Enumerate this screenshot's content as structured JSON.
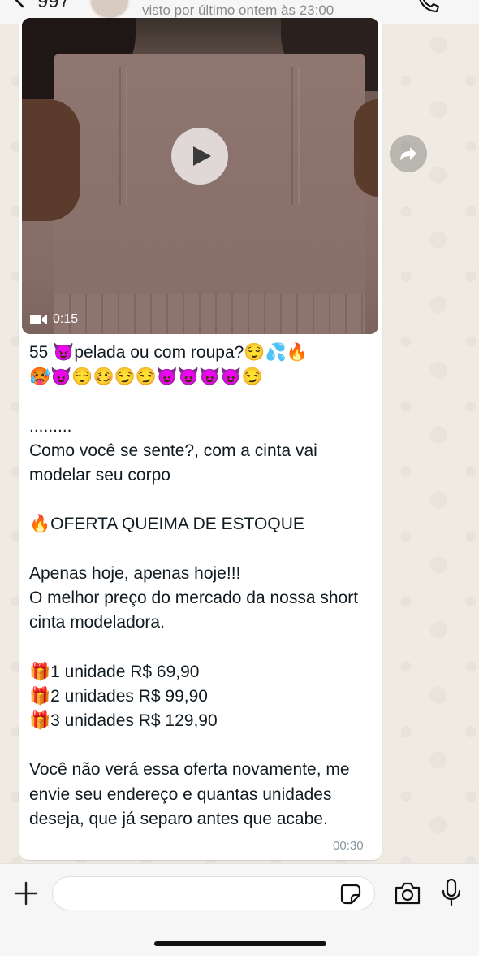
{
  "header": {
    "contact_name": "997",
    "last_seen": "visto por último ontem às 23:00"
  },
  "message": {
    "video_duration": "0:15",
    "text": "55 😈pelada ou com roupa?😌💦🔥\n🥵😈😌🥴😏😏😈😈😈😈😏\n\n.........\nComo você se sente?, com a cinta vai modelar seu corpo\n\n🔥OFERTA QUEIMA DE ESTOQUE\n\nApenas hoje, apenas hoje!!!\nO melhor preço do mercado da nossa short cinta modeladora.\n\n🎁1 unidade R$ 69,90\n🎁2 unidades R$ 99,90\n🎁3 unidades R$ 129,90\n\nVocê não verá essa oferta novamente, me envie seu endereço e quantas unidades deseja, que já separo antes que acabe.",
    "time": "00:30"
  },
  "input": {
    "value": "",
    "placeholder": ""
  },
  "icons": {
    "back": "chevron-left-icon",
    "call": "phone-icon",
    "play": "play-icon",
    "video": "video-camera-icon",
    "forward": "forward-icon",
    "plus": "plus-icon",
    "sticker": "sticker-icon",
    "camera": "camera-icon",
    "mic": "microphone-icon"
  },
  "colors": {
    "accent": "#007aff",
    "bubble": "#ffffff",
    "wallpaper": "#efeae2",
    "timestamp": "#8696a0"
  }
}
